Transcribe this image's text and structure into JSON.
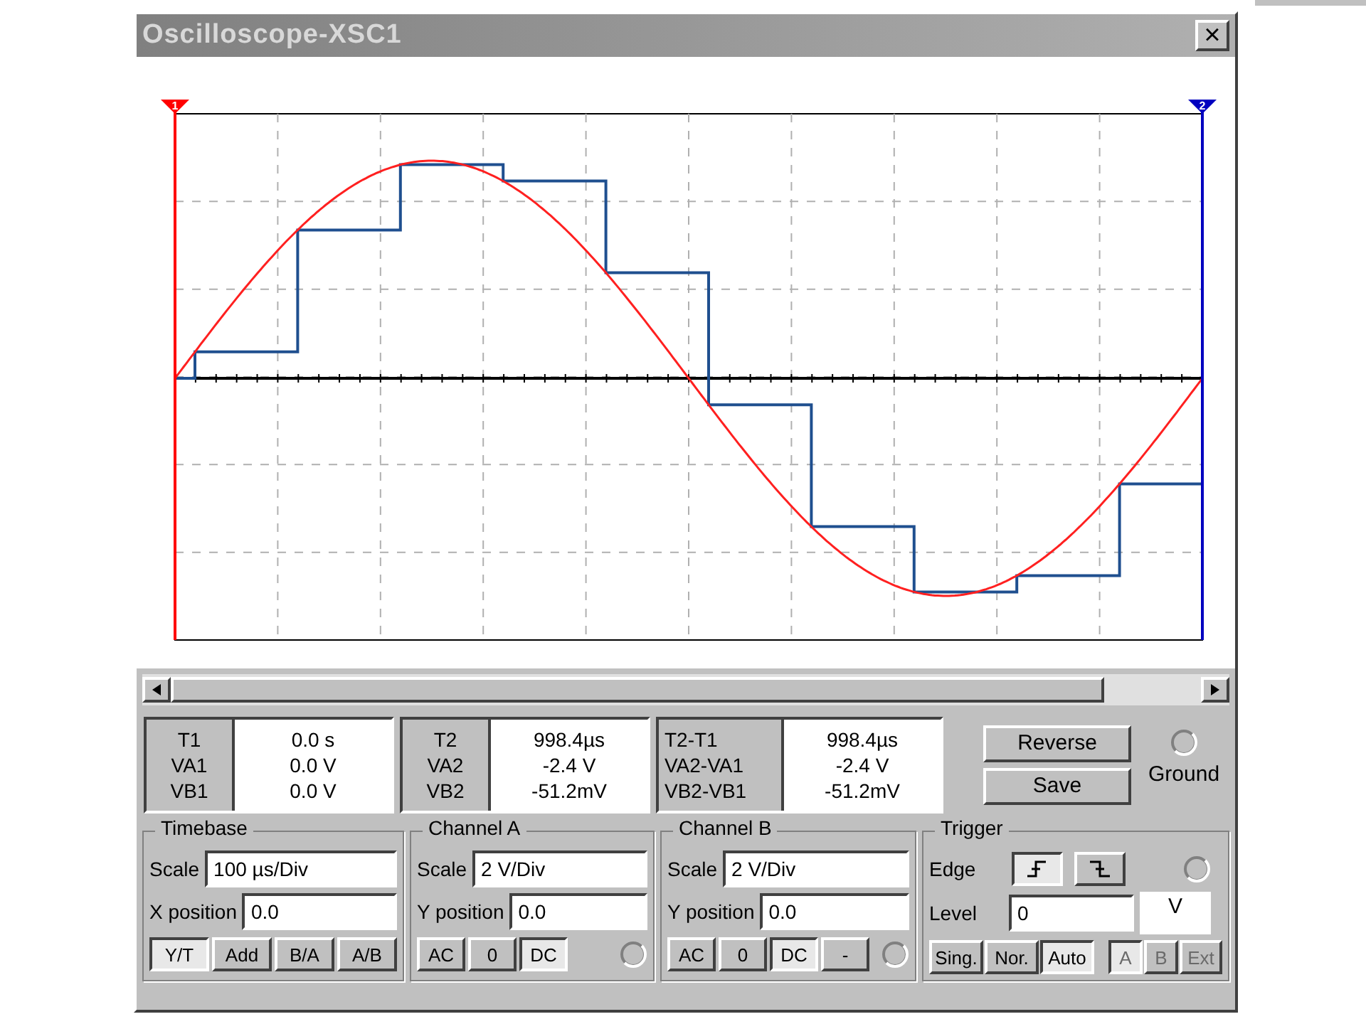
{
  "window": {
    "title": "Oscilloscope-XSC1",
    "close": "×"
  },
  "cursors": [
    {
      "label": "1",
      "color": "#ff0000"
    },
    {
      "label": "2",
      "color": "#0000c0"
    }
  ],
  "readouts": [
    {
      "labels": [
        "T1",
        "VA1",
        "VB1"
      ],
      "values": [
        "0.0 s",
        "0.0 V",
        "0.0 V"
      ]
    },
    {
      "labels": [
        "T2",
        "VA2",
        "VB2"
      ],
      "values": [
        "998.4µs",
        "-2.4 V",
        "-51.2mV"
      ]
    },
    {
      "labels": [
        "T2-T1",
        "VA2-VA1",
        "VB2-VB1"
      ],
      "values": [
        "998.4µs",
        "-2.4 V",
        "-51.2mV"
      ]
    }
  ],
  "actions": [
    {
      "label": "Reverse"
    },
    {
      "label": "Save"
    }
  ],
  "ground": {
    "label": "Ground"
  },
  "timebase": {
    "title": "Timebase",
    "fields": [
      {
        "label": "Scale",
        "value": "100 µs/Div"
      },
      {
        "label": "X position",
        "value": "0.0"
      }
    ],
    "modes": [
      {
        "label": "Y/T",
        "selected": true
      },
      {
        "label": "Add",
        "selected": false
      },
      {
        "label": "B/A",
        "selected": false
      },
      {
        "label": "A/B",
        "selected": false
      }
    ]
  },
  "channels": [
    {
      "title": "Channel A",
      "fields": [
        {
          "label": "Scale",
          "value": "2 V/Div"
        },
        {
          "label": "Y position",
          "value": "0.0"
        }
      ],
      "coupling": [
        {
          "label": "AC",
          "selected": false
        },
        {
          "label": "0",
          "selected": false
        },
        {
          "label": "DC",
          "selected": true
        }
      ]
    },
    {
      "title": "Channel B",
      "fields": [
        {
          "label": "Scale",
          "value": "2 V/Div"
        },
        {
          "label": "Y position",
          "value": "0.0"
        }
      ],
      "coupling": [
        {
          "label": "AC",
          "selected": false
        },
        {
          "label": "0",
          "selected": false
        },
        {
          "label": "DC",
          "selected": true
        },
        {
          "label": "-",
          "selected": false
        }
      ]
    }
  ],
  "trigger": {
    "title": "Trigger",
    "edge_label": "Edge",
    "edges": [
      {
        "kind": "rising",
        "selected": true
      },
      {
        "kind": "falling",
        "selected": false
      }
    ],
    "level_label": "Level",
    "level_value": "0",
    "level_unit": "V",
    "modes": [
      {
        "label": "Sing.",
        "selected": false
      },
      {
        "label": "Nor.",
        "selected": false
      },
      {
        "label": "Auto",
        "selected": true
      }
    ],
    "sources": [
      {
        "label": "A",
        "selected": true,
        "disabled": true
      },
      {
        "label": "B",
        "selected": false,
        "disabled": true
      },
      {
        "label": "Ext",
        "selected": false,
        "disabled": true
      }
    ]
  }
}
